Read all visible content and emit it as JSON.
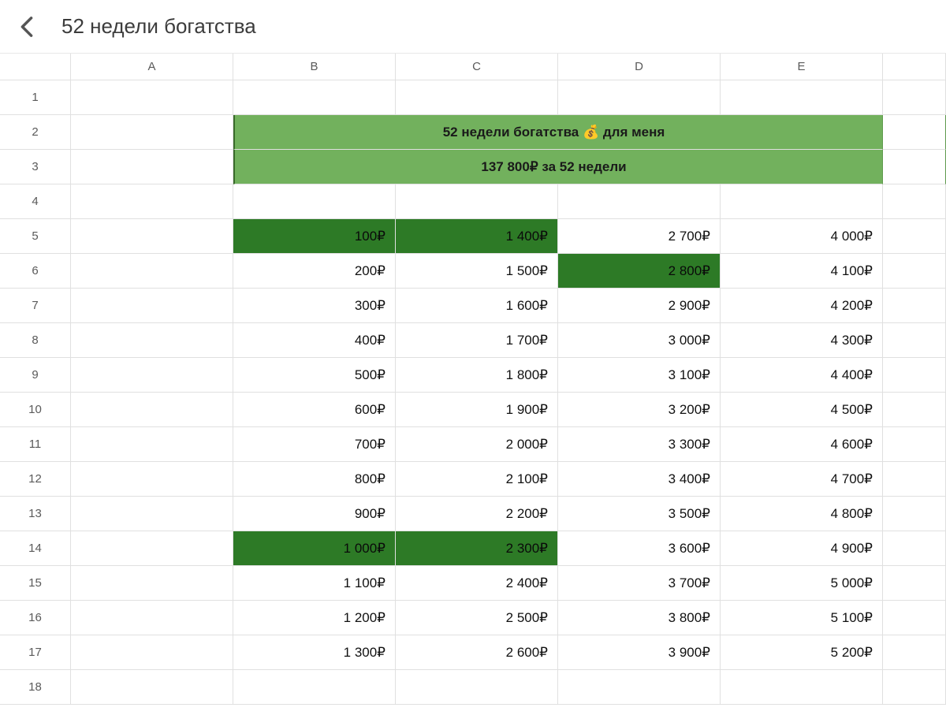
{
  "header": {
    "title": "52 недели богатства"
  },
  "columns": [
    "A",
    "B",
    "C",
    "D",
    "E"
  ],
  "banner": {
    "line1": "52 недели богатства 💰 для меня",
    "line2": "137 800₽ за 52 недели"
  },
  "rows": [
    {
      "n": 1,
      "A": "",
      "B": "",
      "C": "",
      "D": "",
      "E": ""
    },
    {
      "n": 2,
      "banner": "line1"
    },
    {
      "n": 3,
      "banner": "line2"
    },
    {
      "n": 4,
      "A": "",
      "B": "",
      "C": "",
      "D": "",
      "E": ""
    },
    {
      "n": 5,
      "A": "",
      "B": "100₽",
      "C": "1 400₽",
      "D": "2 700₽",
      "E": "4 000₽",
      "hl": [
        "B",
        "C"
      ]
    },
    {
      "n": 6,
      "A": "",
      "B": "200₽",
      "C": "1 500₽",
      "D": "2 800₽",
      "E": "4 100₽",
      "hl": [
        "D"
      ]
    },
    {
      "n": 7,
      "A": "",
      "B": "300₽",
      "C": "1 600₽",
      "D": "2 900₽",
      "E": "4 200₽"
    },
    {
      "n": 8,
      "A": "",
      "B": "400₽",
      "C": "1 700₽",
      "D": "3 000₽",
      "E": "4 300₽"
    },
    {
      "n": 9,
      "A": "",
      "B": "500₽",
      "C": "1 800₽",
      "D": "3 100₽",
      "E": "4 400₽"
    },
    {
      "n": 10,
      "A": "",
      "B": "600₽",
      "C": "1 900₽",
      "D": "3 200₽",
      "E": "4 500₽"
    },
    {
      "n": 11,
      "A": "",
      "B": "700₽",
      "C": "2 000₽",
      "D": "3 300₽",
      "E": "4 600₽"
    },
    {
      "n": 12,
      "A": "",
      "B": "800₽",
      "C": "2 100₽",
      "D": "3 400₽",
      "E": "4 700₽"
    },
    {
      "n": 13,
      "A": "",
      "B": "900₽",
      "C": "2 200₽",
      "D": "3 500₽",
      "E": "4 800₽"
    },
    {
      "n": 14,
      "A": "",
      "B": "1 000₽",
      "C": "2 300₽",
      "D": "3 600₽",
      "E": "4 900₽",
      "hl": [
        "B",
        "C"
      ]
    },
    {
      "n": 15,
      "A": "",
      "B": "1 100₽",
      "C": "2 400₽",
      "D": "3 700₽",
      "E": "5 000₽"
    },
    {
      "n": 16,
      "A": "",
      "B": "1 200₽",
      "C": "2 500₽",
      "D": "3 800₽",
      "E": "5 100₽"
    },
    {
      "n": 17,
      "A": "",
      "B": "1 300₽",
      "C": "2 600₽",
      "D": "3 900₽",
      "E": "5 200₽"
    },
    {
      "n": 18,
      "A": "",
      "B": "",
      "C": "",
      "D": "",
      "E": ""
    }
  ]
}
